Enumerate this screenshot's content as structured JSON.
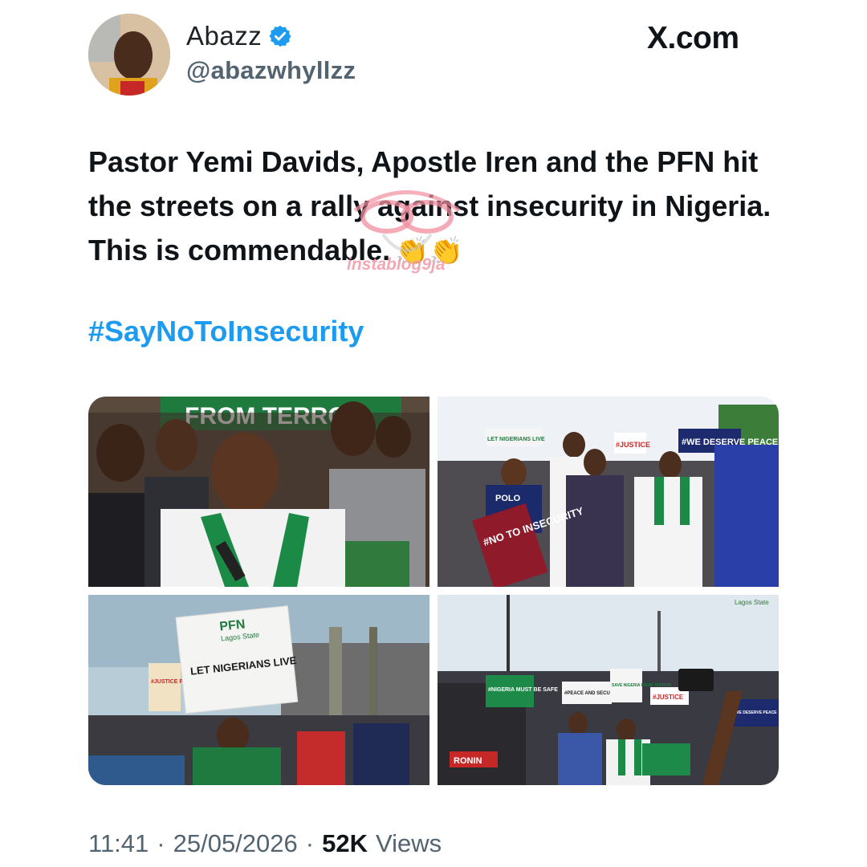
{
  "author": {
    "display_name": "Abazz",
    "handle": "@abazwhyllzz",
    "verified": true
  },
  "platform_label": "X.com",
  "tweet": {
    "text": "Pastor Yemi Davids, Apostle Iren and the PFN hit the streets on a rally against insecurity in Nigeria. This is commendable.",
    "emoji": "👏👏",
    "hashtag": "#SayNoToInsecurity"
  },
  "watermark": "instablog9ja",
  "photos": [
    {
      "signs": [
        "FROM TERROR"
      ]
    },
    {
      "signs": [
        "#NO TO INSECURITY",
        "#WE DESERVE PEACE",
        "#JUSTICE",
        "LET NIGERIANS LIVE",
        "POLO"
      ]
    },
    {
      "signs": [
        "PFN",
        "Lagos State",
        "LET NIGERIANS LIVE",
        "#JUSTICE FOR THE OPPRESSED"
      ]
    },
    {
      "signs": [
        "#PEACE AND SECURITY NOW",
        "SAVE NIGERIA FROM TERROR",
        "#NIGERIA MUST BE SAFE",
        "#JUSTICE",
        "#WE DESERVE PEACE",
        "RONIN",
        "Lagos State"
      ]
    }
  ],
  "footer": {
    "time": "11:41",
    "date": "25/05/2026",
    "views_count": "52K",
    "views_label": "Views"
  },
  "colors": {
    "accent_blue": "#1d9bf0",
    "muted_gray": "#536471",
    "text": "#0f1419"
  }
}
